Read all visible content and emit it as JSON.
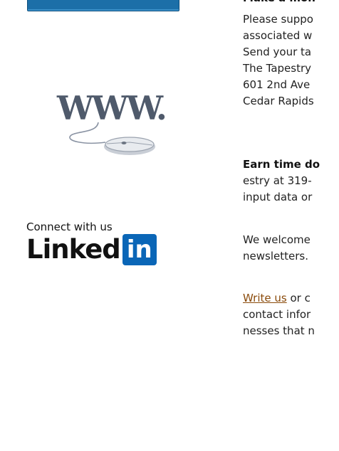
{
  "header": {
    "cut_heading": "Make a mon"
  },
  "sections": {
    "donate": {
      "lines": [
        "Please suppo",
        "associated w",
        "Send your ta",
        "The Tapestry",
        "601 2nd Ave",
        "Cedar Rapids"
      ]
    },
    "volunteer": {
      "heading": "Earn time do",
      "lines": [
        "estry at 319-",
        "input data or"
      ]
    },
    "newsletter": {
      "lines": [
        "We welcome",
        "newsletters."
      ]
    },
    "contact": {
      "link_text": "Write us",
      "line1_rest": " or c",
      "lines": [
        "contact infor",
        "nesses that n"
      ]
    }
  },
  "graphics": {
    "www_text": "WWW.",
    "www_icon": "computer-mouse-icon",
    "connect_label": "Connect with us",
    "linkedin_word": "Linked",
    "linkedin_badge": "in"
  },
  "colors": {
    "banner_blue": "#1c6fa8",
    "linkedin_blue": "#0a66b7",
    "link_color": "#8a4a0a"
  }
}
